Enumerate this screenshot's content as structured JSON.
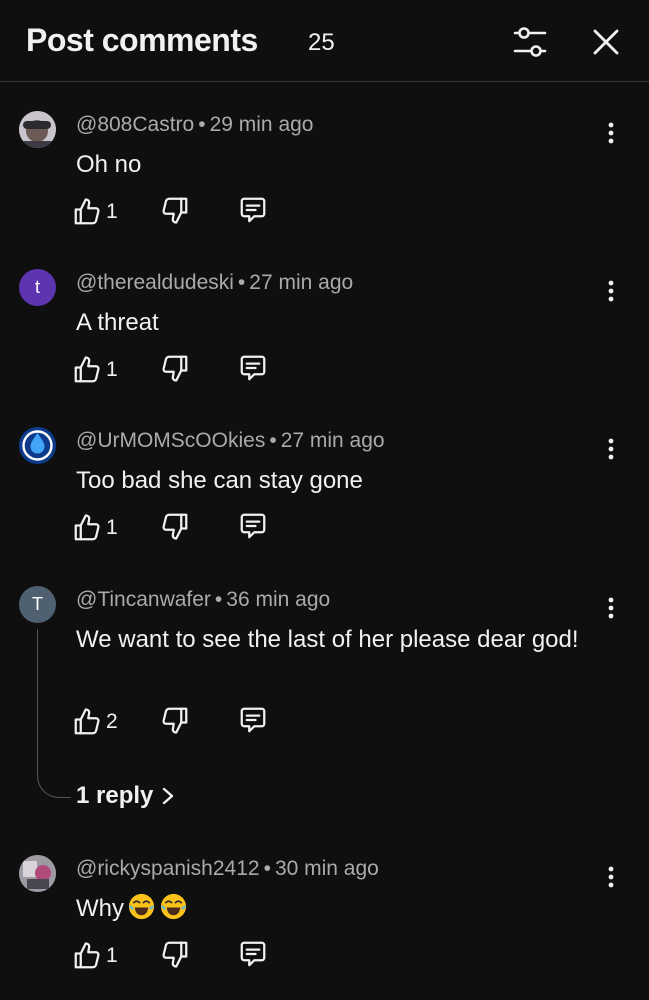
{
  "header": {
    "title": "Post comments",
    "count": "25"
  },
  "icons": {
    "filter": "sliders-icon",
    "close": "close-icon",
    "like": "thumbs-up-icon",
    "dislike": "thumbs-down-icon",
    "reply": "message-square-icon",
    "more": "more-vertical-icon",
    "chevron": "chevron-right-icon"
  },
  "comments": [
    {
      "author": "@808Castro",
      "time": "29 min ago",
      "text": "Oh no",
      "likes": "1",
      "avatar_letter": "",
      "avatar_color": "#5a5560"
    },
    {
      "author": "@therealdudeski",
      "time": "27 min ago",
      "text": "A threat",
      "likes": "1",
      "avatar_letter": "t",
      "avatar_color": "#5e35b1"
    },
    {
      "author": "@UrMOMScOOkies",
      "time": "27 min ago",
      "text": "Too bad she can stay gone",
      "likes": "1",
      "avatar_letter": "",
      "avatar_color": "#1565c0"
    },
    {
      "author": "@Tincanwafer",
      "time": "36 min ago",
      "text": "We want to see the last of her please dear god!",
      "likes": "2",
      "avatar_letter": "T",
      "avatar_color": "#4f6170",
      "replies": "1 reply"
    },
    {
      "author": "@rickyspanish2412",
      "time": "30 min ago",
      "text": "Why",
      "emoji": "😂😂",
      "likes": "1",
      "avatar_letter": "",
      "avatar_color": "#7a6f7c"
    }
  ],
  "colors": {
    "background": "#0f0f0f",
    "text": "#f1f1f1",
    "meta": "#aaaaaa"
  }
}
